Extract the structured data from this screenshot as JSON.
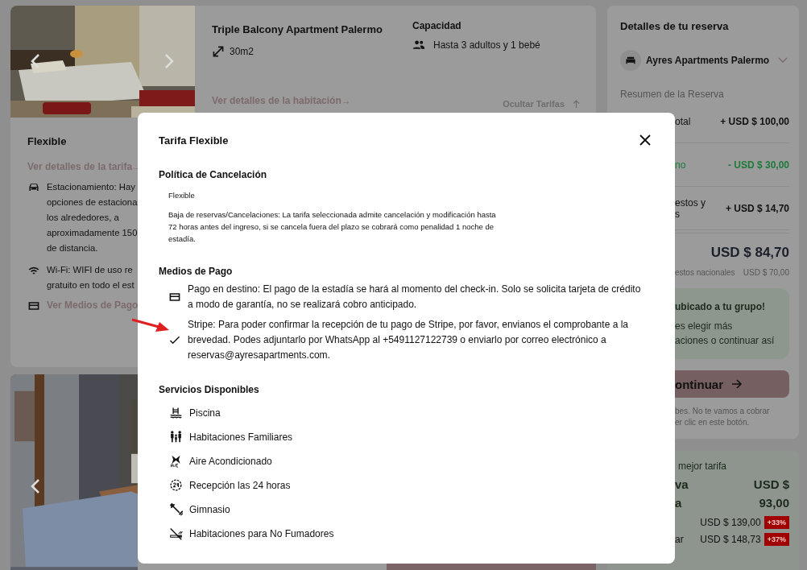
{
  "room_card": {
    "title": "Triple Balcony Apartment Palermo",
    "size": "30m2",
    "capacity_label": "Capacidad",
    "capacity": "Hasta 3 adultos y 1 bebé",
    "room_link": "Ver detalles de la habitación→",
    "hide_rates": "Ocultar Tarifas",
    "rate_name": "Flexible",
    "rate_link": "Ver detalles de la tarifa→",
    "amenities": [
      {
        "kind": "parking",
        "lines": [
          "Estacionamiento: Hay",
          "opciones de estaciona",
          "los alrededores, a",
          "aproximadamente 150",
          "de distancia."
        ]
      },
      {
        "kind": "wifi",
        "lines": [
          "Wi-Fi: WIFI de uso re",
          "gratuito en todo el est"
        ]
      }
    ],
    "payment_link": "Ver Medios de Pago"
  },
  "booking_panel": {
    "title": "Detalles de tu reserva",
    "hotel": "Ayres Apartments Palermo",
    "summary_label": "Resumen de la Reserva",
    "rows": [
      {
        "kind": "charge",
        "label": [
          "otal"
        ],
        "amount": "+ USD $ 100,00"
      },
      {
        "kind": "discount",
        "label": [
          "no"
        ],
        "amount": "- USD $ 30,00"
      },
      {
        "kind": "charge",
        "label": [
          "estos y",
          "s"
        ],
        "amount": "+ USD $ 14,70"
      }
    ],
    "total": "USD $ 84,70",
    "tax_note": "estos nacionales",
    "tax_amount": "USD $ 70,00",
    "notice": {
      "title": "ubicado a tu grupo!",
      "lines": [
        "es elegir más",
        "aciones o continuar así"
      ]
    },
    "continue_button": "ontinuar",
    "footnote": [
      "bes. No te vamos a cobrar",
      "er clic en este botón."
    ]
  },
  "best_rate": {
    "title": "mejor tarifa",
    "label_lines": [
      "va",
      "a"
    ],
    "price_lines": [
      "USD $",
      "93,00"
    ],
    "offers": [
      {
        "price": "USD $ 139,00",
        "badge": "+33%"
      },
      {
        "label": "ar",
        "price": "USD $ 148,73",
        "badge": "+37%"
      }
    ]
  },
  "modal": {
    "title": "Tarifa Flexible",
    "cancel_heading": "Política de Cancelación",
    "cancel_name": "Flexible",
    "cancel_text": "Baja de reservas/Cancelaciones: La tarifa seleccionada admite cancelación y modificación hasta 72 horas antes del ingreso, si se cancela fuera del plazo se cobrará como penalidad 1 noche de estadía.",
    "payment_heading": "Medios de Pago",
    "payments": [
      {
        "kind": "card",
        "text": "Pago en destino: El pago de la estadía se hará al momento del check-in. Solo se solicita tarjeta de crédito a modo de garantía, no se realizará cobro anticipado."
      },
      {
        "kind": "check",
        "text": "Stripe: Para poder confirmar la recepción de tu pago de Stripe, por favor, envianos el comprobante a la brevedad. Podes adjuntarlo por WhatsApp al +5491127122739 o enviarlo por correo electrónico a reservas@ayresapartments.com."
      }
    ],
    "services_heading": "Servicios Disponibles",
    "services": [
      {
        "kind": "pool",
        "label": "Piscina"
      },
      {
        "kind": "family",
        "label": "Habitaciones Familiares"
      },
      {
        "kind": "ac",
        "label": "Aire Acondicionado"
      },
      {
        "kind": "reception24",
        "label": "Recepción las 24 horas"
      },
      {
        "kind": "gym",
        "label": "Gimnasio"
      },
      {
        "kind": "nosmoking",
        "label": "Habitaciones para No Fumadores"
      }
    ]
  }
}
